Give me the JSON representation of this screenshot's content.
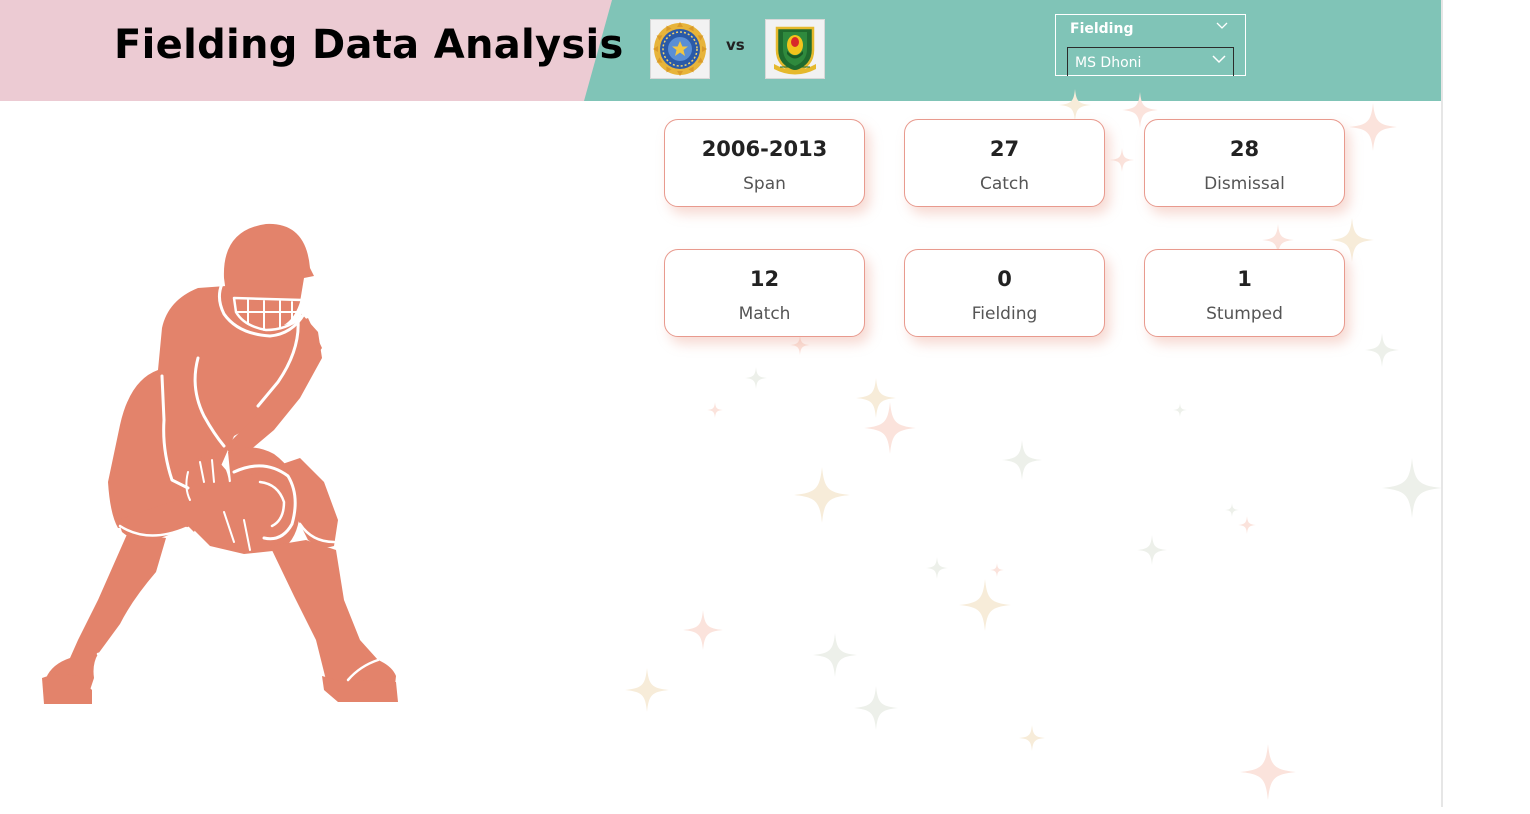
{
  "header": {
    "title": "Fielding Data Analysis",
    "vs_text": "vs",
    "team_logos": [
      "india-cricket-logo",
      "south-africa-cricket-logo"
    ]
  },
  "slicer": {
    "category_label": "Fielding",
    "selected_player": "MS Dhoni"
  },
  "cards": [
    {
      "value": "2006-2013",
      "label": "Span"
    },
    {
      "value": "27",
      "label": "Catch"
    },
    {
      "value": "28",
      "label": "Dismissal"
    },
    {
      "value": "12",
      "label": "Match"
    },
    {
      "value": "0",
      "label": "Fielding"
    },
    {
      "value": "1",
      "label": "Stumped"
    }
  ],
  "colors": {
    "header_pink": "#eccbd3",
    "header_teal": "#80c4b7",
    "accent_orange": "#e3836b",
    "card_border": "#e89a8e"
  },
  "illustration": "wicket-keeper-silhouette"
}
